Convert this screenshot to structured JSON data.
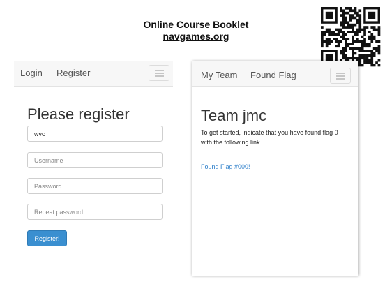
{
  "booklet": {
    "title": "Online Course Booklet",
    "url": "navgames.org"
  },
  "left_app": {
    "nav": {
      "login": "Login",
      "register": "Register"
    },
    "heading": "Please register",
    "fields": {
      "team_value": "wvc",
      "username_placeholder": "Username",
      "password_placeholder": "Password",
      "repeat_password_placeholder": "Repeat password"
    },
    "submit_label": "Register!"
  },
  "right_app": {
    "nav": {
      "my_team": "My Team",
      "found_flag": "Found Flag"
    },
    "heading": "Team jmc",
    "instructions": "To get started, indicate that you have found flag 0 with the following link.",
    "link": "Found Flag #000!"
  },
  "colors": {
    "accent": "#3a8fd0",
    "link": "#2a7dc9",
    "navbar_bg": "#f7f7f7"
  },
  "icons": [
    "qr-code-icon",
    "menu-icon"
  ]
}
